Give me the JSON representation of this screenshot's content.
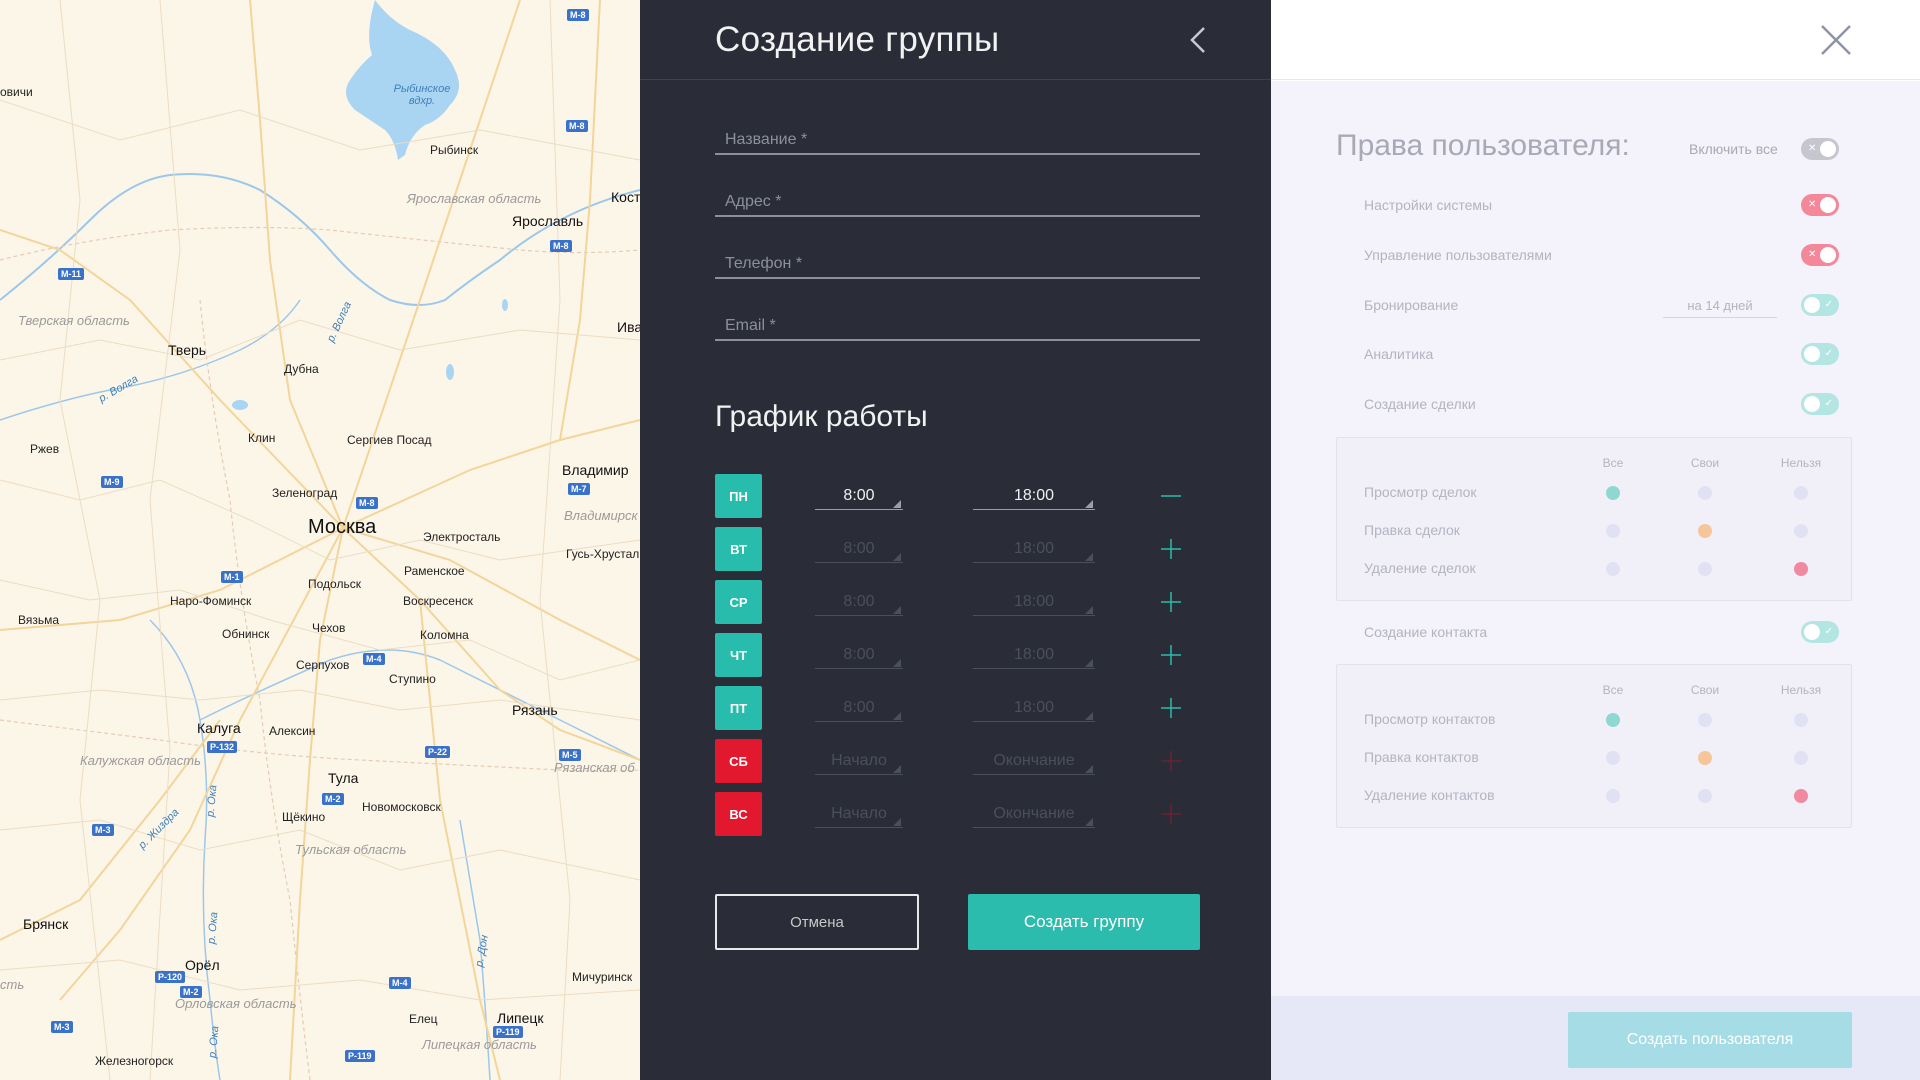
{
  "map": {
    "cities": [
      "Рыбинск",
      "Ярославль",
      "Кост",
      "Ива",
      "Тверь",
      "Дубна",
      "Ржев",
      "Клин",
      "Сергиев Посад",
      "Владимир",
      "Зеленоград",
      "Москва",
      "Электросталь",
      "Гусь-Хрустал",
      "Раменское",
      "Подольск",
      "Наро-Фоминск",
      "Воскресенск",
      "Вязьма",
      "Обнинск",
      "Чехов",
      "Коломна",
      "Серпухов",
      "Ступино",
      "Рязань",
      "Калуга",
      "Алексин",
      "Тула",
      "Щёкино",
      "Новомосковск",
      "Брянск",
      "Орёл",
      "Мичуринск",
      "Елец",
      "Липецк",
      "Железногорск",
      "овичи"
    ],
    "regions": [
      "Ярославская область",
      "Тверская область",
      "Владимирск",
      "Калужская область",
      "Рязанская об",
      "Тульская область",
      "Орловская область",
      "Липецкая область",
      "сть"
    ],
    "water": [
      "Рыбинское вдхр.",
      "р. Волга",
      "р. Волга",
      "р. Ока",
      "р. Жиздра",
      "р. Ока",
      "р. Ока",
      "р. Дон"
    ],
    "roads": [
      "М-8",
      "М-8",
      "М-8",
      "М-11",
      "М-9",
      "М-8",
      "М-7",
      "М-1",
      "М-4",
      "Р-132",
      "Р-22",
      "М-5",
      "М-2",
      "М-3",
      "Р-120",
      "М-2",
      "М-4",
      "М-3",
      "Р-119",
      "Р-119"
    ]
  },
  "group_panel": {
    "title": "Создание группы",
    "fields": [
      {
        "placeholder": "Название *",
        "value": ""
      },
      {
        "placeholder": "Адрес *",
        "value": ""
      },
      {
        "placeholder": "Телефон *",
        "value": ""
      },
      {
        "placeholder": "Email *",
        "value": ""
      }
    ],
    "schedule_title": "График работы",
    "days": [
      {
        "label": "ПН",
        "start": "8:00",
        "end": "18:00",
        "state": "on",
        "action": "minus"
      },
      {
        "label": "ВТ",
        "start": "8:00",
        "end": "18:00",
        "state": "on",
        "action": "plus"
      },
      {
        "label": "СР",
        "start": "8:00",
        "end": "18:00",
        "state": "on",
        "action": "plus"
      },
      {
        "label": "ЧТ",
        "start": "8:00",
        "end": "18:00",
        "state": "on",
        "action": "plus"
      },
      {
        "label": "ПТ",
        "start": "8:00",
        "end": "18:00",
        "state": "on",
        "action": "plus"
      },
      {
        "label": "СБ",
        "start": "Начало",
        "end": "Окончание",
        "state": "off",
        "action": "plus"
      },
      {
        "label": "ВС",
        "start": "Начало",
        "end": "Окончание",
        "state": "off",
        "action": "plus"
      }
    ],
    "cancel_label": "Отмена",
    "create_label": "Создать группу",
    "colors": {
      "bg": "#2a2d37",
      "accent": "#2bbcad",
      "danger": "#e2192e"
    }
  },
  "user_panel": {
    "rights_title": "Права пользователя:",
    "enable_all_label": "Включить все",
    "perm_system": "Настройки системы",
    "perm_users": "Управление пользователями",
    "perm_booking": "Бронирование",
    "booking_value": "на 14 дней",
    "perm_analytics": "Аналитика",
    "perm_deal_create": "Создание сделки",
    "perm_contact_create": "Создание контакта",
    "col_all": "Все",
    "col_own": "Свои",
    "col_none": "Нельзя",
    "deal_view": "Просмотр сделок",
    "deal_edit": "Правка сделок",
    "deal_delete": "Удаление сделок",
    "contact_view": "Просмотр контактов",
    "contact_edit": "Правка контактов",
    "contact_delete": "Удаление контактов",
    "create_user_label": "Создать пользователя"
  }
}
